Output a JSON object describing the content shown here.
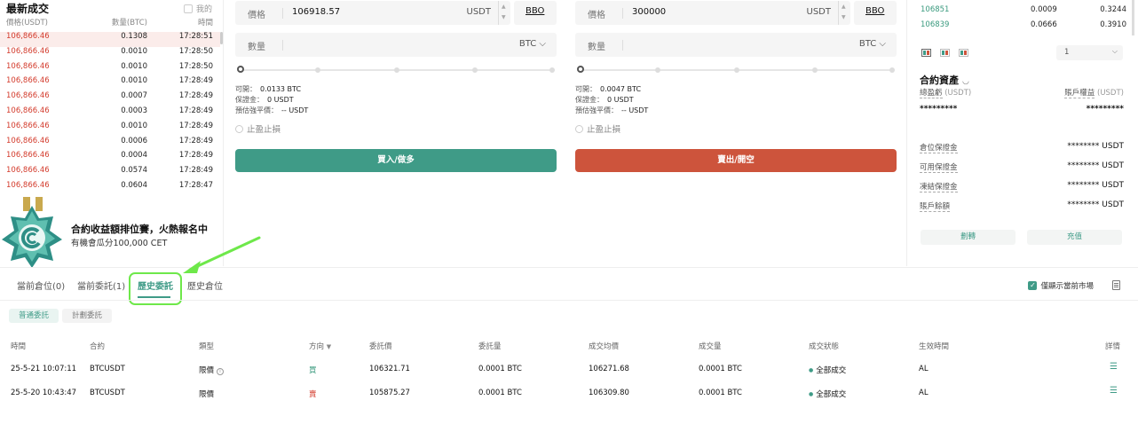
{
  "trades": {
    "title": "最新成交",
    "mine_label": "我的",
    "headers": {
      "price": "價格(USDT)",
      "qty": "數量(BTC)",
      "time": "時間"
    },
    "rows": [
      {
        "price": "106,866.46",
        "qty": "0.1308",
        "time": "17:28:51"
      },
      {
        "price": "106,866.46",
        "qty": "0.0010",
        "time": "17:28:50"
      },
      {
        "price": "106,866.46",
        "qty": "0.0010",
        "time": "17:28:50"
      },
      {
        "price": "106,866.46",
        "qty": "0.0010",
        "time": "17:28:49"
      },
      {
        "price": "106,866.46",
        "qty": "0.0007",
        "time": "17:28:49"
      },
      {
        "price": "106,866.46",
        "qty": "0.0003",
        "time": "17:28:49"
      },
      {
        "price": "106,866.46",
        "qty": "0.0010",
        "time": "17:28:49"
      },
      {
        "price": "106,866.46",
        "qty": "0.0006",
        "time": "17:28:49"
      },
      {
        "price": "106,866.46",
        "qty": "0.0004",
        "time": "17:28:49"
      },
      {
        "price": "106,866.46",
        "qty": "0.0574",
        "time": "17:28:49"
      },
      {
        "price": "106,866.46",
        "qty": "0.0604",
        "time": "17:28:47"
      }
    ]
  },
  "promo": {
    "title": "合約收益額排位賽，火熱報名中",
    "subtitle": "有機會瓜分100,000 CET"
  },
  "buy_form": {
    "price_label": "價格",
    "price_value": "106918.57",
    "price_unit": "USDT",
    "bbo": "BBO",
    "qty_label": "數量",
    "qty_unit": "BTC",
    "available_label": "可開：",
    "available_value": "0.0133 BTC",
    "margin_label": "保證金：",
    "margin_value": "0 USDT",
    "liq_label": "預估強平價：",
    "liq_value": "-- USDT",
    "tpsl": "止盈止損",
    "action": "買入/做多"
  },
  "sell_form": {
    "price_label": "價格",
    "price_value": "300000",
    "price_unit": "USDT",
    "bbo": "BBO",
    "qty_label": "數量",
    "qty_unit": "BTC",
    "available_label": "可開：",
    "available_value": "0.0047 BTC",
    "margin_label": "保證金：",
    "margin_value": "0 USDT",
    "liq_label": "預估強平價：",
    "liq_value": "-- USDT",
    "tpsl": "止盈止損",
    "action": "賣出/開空"
  },
  "orderbook": {
    "rows": [
      {
        "price": "106851",
        "amount": "0.0009",
        "total": "0.3244"
      },
      {
        "price": "106839",
        "amount": "0.0666",
        "total": "0.3910"
      }
    ],
    "depth_value": "1"
  },
  "assets": {
    "title": "合約資產",
    "total_pnl_label": "總盈虧",
    "total_pnl_unit": "(USDT)",
    "equity_label": "賬戶權益",
    "equity_unit": "(USDT)",
    "total_pnl_value": "*********",
    "equity_value": "*********",
    "rows": [
      {
        "label": "倉位保證金",
        "value": "******** USDT"
      },
      {
        "label": "可用保證金",
        "value": "******** USDT"
      },
      {
        "label": "凍結保證金",
        "value": "******** USDT"
      },
      {
        "label": "賬戶餘額",
        "value": "******** USDT"
      }
    ],
    "transfer_button": "劃轉",
    "deposit_button": "充值"
  },
  "orders": {
    "tabs": [
      "當前倉位(0)",
      "當前委託(1)",
      "歷史委託",
      "歷史倉位"
    ],
    "active_tab": "歷史委託",
    "current_market_only": "僅顯示當前市場",
    "subtabs": [
      "普通委託",
      "計劃委託"
    ],
    "headers": [
      "時間",
      "合約",
      "類型",
      "方向",
      "委託價",
      "委託量",
      "成交均價",
      "成交量",
      "成交狀態",
      "生效時間",
      "詳情"
    ],
    "rows": [
      {
        "time": "25-5-21 10:07:11",
        "contract": "BTCUSDT",
        "type": "限價",
        "side": "買",
        "side_kind": "buy",
        "price": "106321.71",
        "qty": "0.0001 BTC",
        "avg_price": "106271.68",
        "filled": "0.0001 BTC",
        "status": "全部成交",
        "effective": "AL"
      },
      {
        "time": "25-5-20 10:43:47",
        "contract": "BTCUSDT",
        "type": "限價",
        "side": "賣",
        "side_kind": "sell",
        "price": "105875.27",
        "qty": "0.0001 BTC",
        "avg_price": "106309.80",
        "filled": "0.0001 BTC",
        "status": "全部成交",
        "effective": "AL"
      }
    ]
  },
  "colors": {
    "buy": "#3f9b87",
    "sell": "#cd543c",
    "highlight": "#6ee84a"
  }
}
